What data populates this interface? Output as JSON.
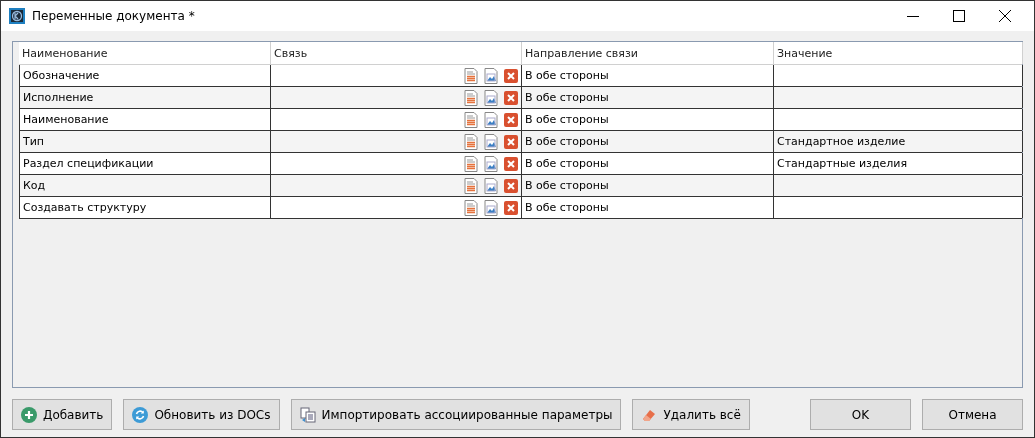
{
  "window": {
    "title": "Переменные документа *"
  },
  "table": {
    "columns": [
      "Наименование",
      "Связь",
      "Направление связи",
      "Значение"
    ],
    "rows": [
      {
        "name": "Обозначение",
        "direction": "В обе стороны"
      },
      {
        "name": "Исполнение",
        "direction": "В обе стороны"
      },
      {
        "name": "Наименование",
        "direction": "В обе стороны"
      },
      {
        "name": "Тип",
        "direction": "В обе стороны",
        "value": "Стандартное изделие"
      },
      {
        "name": "Раздел спецификации",
        "direction": "В обе стороны",
        "value": "Стандартные изделия"
      },
      {
        "name": "Код",
        "direction": "В обе стороны"
      },
      {
        "name": "Создавать структуру",
        "direction": "В обе стороны"
      }
    ]
  },
  "buttons": [
    {
      "kind": "add",
      "label": "Добавить"
    },
    {
      "kind": "refresh",
      "label": "Обновить из DOCs"
    },
    {
      "kind": "import",
      "label": "Импортировать ассоциированные параметры"
    },
    {
      "kind": "erase",
      "label": "Удалить всё"
    }
  ],
  "dialog_buttons": [
    "OK",
    "Отмена"
  ]
}
